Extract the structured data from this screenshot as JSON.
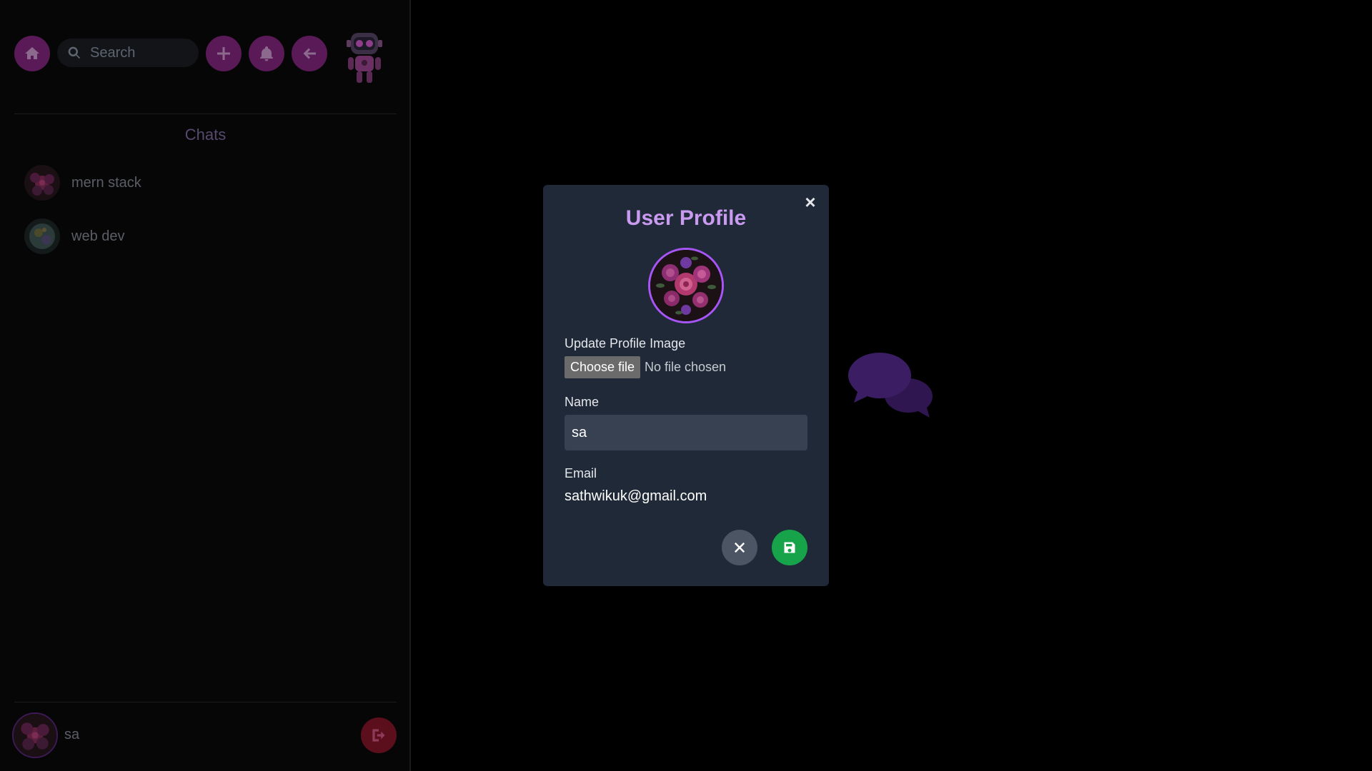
{
  "sidebar": {
    "search_placeholder": "Search",
    "buttons": {
      "home_icon": "home-icon",
      "add_icon": "plus-icon",
      "notifications_icon": "bell-icon",
      "back_icon": "arrow-left-icon"
    },
    "chats_heading": "Chats",
    "chats": [
      {
        "name": "mern stack",
        "avatar_icon": "rose-avatar-icon"
      },
      {
        "name": "web dev",
        "avatar_icon": "planet-avatar-icon"
      }
    ],
    "current_user": {
      "name": "sa",
      "logout_icon": "logout-icon"
    }
  },
  "modal": {
    "title": "User Profile",
    "close_symbol": "×",
    "update_image_label": "Update Profile Image",
    "choose_file_label": "Choose file",
    "no_file_text": "No file chosen",
    "name_label": "Name",
    "name_value": "sa",
    "email_label": "Email",
    "email_value": "sathwikuk@gmail.com",
    "cancel_icon": "x-icon",
    "save_icon": "floppy-disk-icon"
  },
  "colors": {
    "accent_purple": "#a855f7",
    "title_purple": "#c99af0",
    "modal_bg": "#1f2937",
    "save_green": "#16a34a",
    "cancel_gray": "#4b5563"
  }
}
